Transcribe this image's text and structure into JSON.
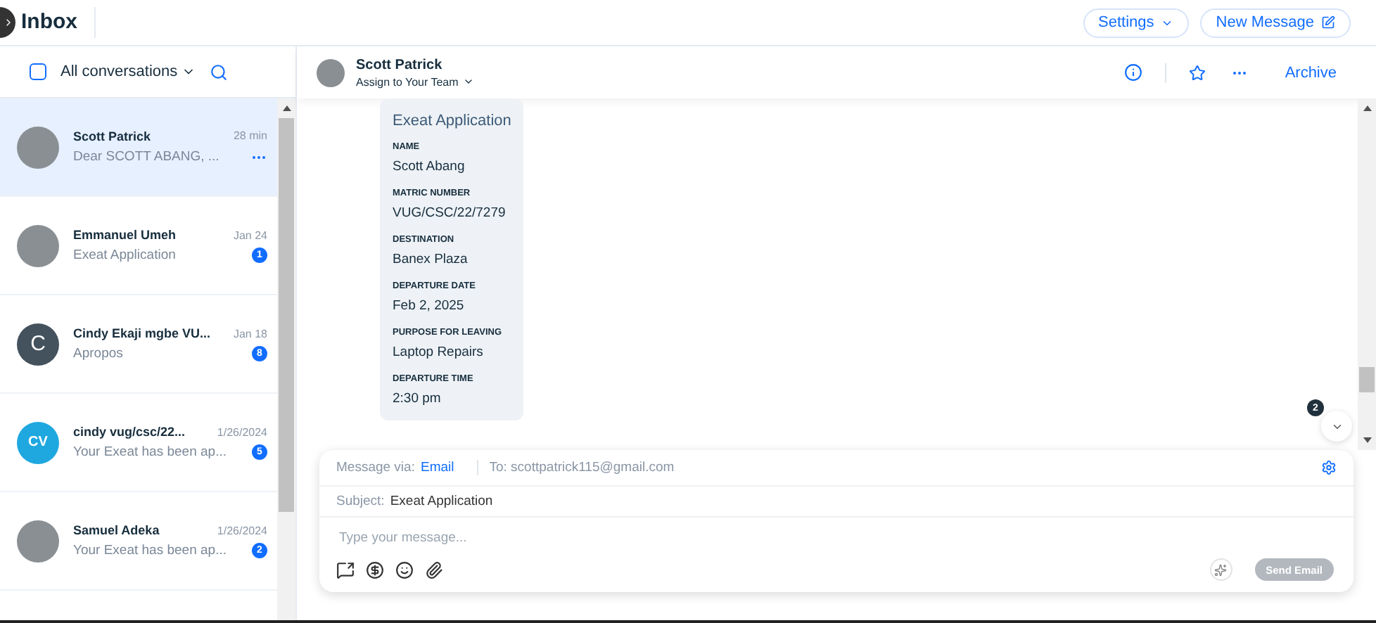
{
  "header": {
    "title": "Inbox",
    "settings_button": "Settings",
    "new_message_button": "New Message"
  },
  "list_header": {
    "select_all_checked": false,
    "filter": "All conversations"
  },
  "conversations": [
    {
      "name": "Scott Patrick",
      "preview": "Dear SCOTT ABANG, ...",
      "time": "28 min",
      "selected": true,
      "avatar": {
        "kind": "photo"
      }
    },
    {
      "name": "Emmanuel Umeh",
      "preview": "Exeat Application",
      "time": "Jan 24",
      "selected": false,
      "avatar": {
        "kind": "photo"
      },
      "unread": "1"
    },
    {
      "name": "Cindy Ekaji mgbe VU...",
      "preview": "Apropos",
      "time": "Jan 18",
      "selected": false,
      "avatar": {
        "kind": "letter",
        "text": "C",
        "color": "#44525e"
      },
      "unread": "8"
    },
    {
      "name": "cindy vug/csc/22...",
      "preview": "Your Exeat has been ap...",
      "time": "1/26/2024",
      "selected": false,
      "avatar": {
        "kind": "letter",
        "text": "CV",
        "color": "#1fa8e0"
      },
      "unread": "5"
    },
    {
      "name": "Samuel Adeka",
      "preview": "Your Exeat has been ap...",
      "time": "1/26/2024",
      "selected": false,
      "avatar": {
        "kind": "photo"
      },
      "unread": "2"
    }
  ],
  "chat_header": {
    "name": "Scott Patrick",
    "assign": "Assign to Your Team",
    "archive": "Archive"
  },
  "message_card": {
    "title": "Exeat Application",
    "fields": [
      {
        "label": "NAME",
        "value": "Scott Abang"
      },
      {
        "label": "MATRIC NUMBER",
        "value": "VUG/CSC/22/7279"
      },
      {
        "label": "DESTINATION",
        "value": "Banex Plaza"
      },
      {
        "label": "DEPARTURE DATE",
        "value": "Feb 2, 2025"
      },
      {
        "label": "PURPOSE FOR LEAVING",
        "value": "Laptop Repairs"
      },
      {
        "label": "DEPARTURE TIME",
        "value": "2:30 pm"
      }
    ]
  },
  "new_messages_count": "2",
  "composer": {
    "via_label": "Message via:",
    "via_value": "Email",
    "to": "To: scottpatrick115@gmail.com",
    "subject_label": "Subject:",
    "subject": "Exeat Application",
    "placeholder": "Type your message...",
    "send_button": "Send Email",
    "send_disabled": true
  }
}
